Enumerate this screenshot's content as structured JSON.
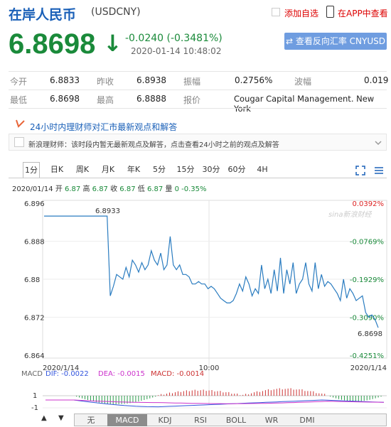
{
  "header": {
    "title": "在岸人民币",
    "code": "(USDCNY)",
    "add_watch": "添加自选",
    "app_view": "在APP中查看"
  },
  "quote": {
    "price": "6.8698",
    "arrow": "↓",
    "change": "-0.0240 (-0.3481%)",
    "time": "2020-01-14 10:48:02",
    "reverse_button": "查看反向汇率 CNYUSD",
    "color_down": "#1a8a3a"
  },
  "stats": {
    "open_label": "今开",
    "open": "6.8833",
    "prev_label": "昨收",
    "prev": "6.8938",
    "amp_label": "振幅",
    "amp": "0.2756%",
    "wave_label": "波幅",
    "wave": "0.019",
    "low_label": "最低",
    "low": "6.8698",
    "high_label": "最高",
    "high": "6.8888",
    "quoter_label": "报价",
    "quoter": "Cougar Capital Management. New York"
  },
  "news": {
    "title": "24小时内理财师对汇市最新观点和解答",
    "text": "新浪理财师：该时段内暂无最新观点及解答，点击查看24小时之前的观点及解答"
  },
  "tabs": [
    "1分",
    "日K",
    "周K",
    "月K",
    "年K",
    "5分",
    "15分",
    "30分",
    "60分",
    "4H"
  ],
  "info_line": {
    "date": "2020/01/14",
    "open_l": "开",
    "open": "6.87",
    "high_l": "高",
    "high": "6.87",
    "close_l": "收",
    "close": "6.87",
    "low_l": "低",
    "low": "6.87",
    "vol_l": "量",
    "vol": "0",
    "pct": "-0.35%"
  },
  "chart_data": {
    "type": "line",
    "ylim": [
      6.864,
      6.896
    ],
    "y_ticks": [
      "6.896",
      "6.888",
      "6.88",
      "6.872",
      "6.864"
    ],
    "right_ticks": [
      "0.0392%",
      "-0.0769%",
      "-0.1929%",
      "-0.3090%",
      "-0.4251%"
    ],
    "x_labels": [
      "2020/1/14",
      "10:00",
      "2020/1/14"
    ],
    "annotations": {
      "max": "6.8933",
      "last": "6.8698"
    },
    "watermark": "sina新浪财经",
    "series": [
      {
        "values": [
          6.8933,
          6.8933,
          6.8933,
          6.8933,
          6.8933,
          6.8933,
          6.8933,
          6.8933,
          6.8933,
          6.8933,
          6.8933,
          6.8933,
          6.8933,
          6.8933,
          6.8933,
          6.8933,
          6.8933,
          6.8933,
          6.8933,
          6.8933,
          6.8933,
          6.8765,
          6.8785,
          6.881,
          6.8805,
          6.88,
          6.8825,
          6.8805,
          6.884,
          6.883,
          6.8815,
          6.8835,
          6.882,
          6.883,
          6.886,
          6.884,
          6.883,
          6.8855,
          6.882,
          6.883,
          6.889,
          6.883,
          6.882,
          6.883,
          6.881,
          6.881,
          6.8805,
          6.879,
          6.879,
          6.8795,
          6.879,
          6.879,
          6.878,
          6.8785,
          6.878,
          6.877,
          6.876,
          6.8755,
          6.875,
          6.875,
          6.8755,
          6.877,
          6.879,
          6.8775,
          6.8805,
          6.879,
          6.8765,
          6.878,
          6.877,
          6.883,
          6.878,
          6.88,
          6.877,
          6.882,
          6.8775,
          6.8845,
          6.877,
          6.882,
          6.879,
          6.8835,
          6.877,
          6.879,
          6.88,
          6.8835,
          6.879,
          6.8775,
          6.8835,
          6.878,
          6.881,
          6.8785,
          6.8795,
          6.879,
          6.878,
          6.877,
          6.8755,
          6.88,
          6.876,
          6.878,
          6.877,
          6.8755,
          6.876,
          6.8765,
          6.873,
          6.872,
          6.8725,
          6.8715,
          6.8698
        ]
      }
    ]
  },
  "macd": {
    "label": "MACD",
    "dif": "DIF: -0.0022",
    "dea": "DEA: -0.0015",
    "macd": "MACD: -0.0014",
    "ticks": [
      "1",
      "-1"
    ],
    "dif_color": "#3355dd",
    "dea_color": "#cc33cc",
    "macd_color": "#cc3333"
  },
  "bottom_tabs": [
    "无",
    "MACD",
    "KDJ",
    "RSI",
    "BOLL",
    "WR",
    "DMI"
  ]
}
